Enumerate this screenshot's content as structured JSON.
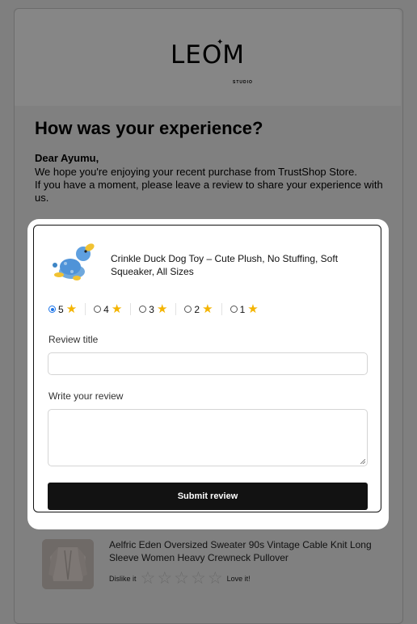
{
  "brand": {
    "logo_text": "LEOM",
    "logo_sub": "STUDIO"
  },
  "heading": "How was your experience?",
  "greeting": "Dear Ayumu,",
  "intro_lines": [
    "We hope you're enjoying your recent purchase from TrustShop Store.",
    "If you have a moment, please leave a review to share your experience with us."
  ],
  "review_form": {
    "product_title": "Crinkle Duck Dog Toy – Cute Plush, No Stuffing, Soft Squeaker, All Sizes",
    "rating_options": [
      "5",
      "4",
      "3",
      "2",
      "1"
    ],
    "selected_rating": "5",
    "title_label": "Review title",
    "title_value": "",
    "review_label": "Write your review",
    "review_value": "",
    "submit_label": "Submit review"
  },
  "next_product": {
    "title": "Aelfric Eden Oversized Sweater 90s Vintage Cable Knit Long Sleeve Women Heavy Crewneck Pullover",
    "dislike_label": "Dislike it",
    "love_label": "Love it!",
    "star_count": 5
  },
  "colors": {
    "accent_star": "#f4b400",
    "button_bg": "#121212",
    "radio_selected": "#1a73e8",
    "overlay": "#7f7f7f"
  }
}
